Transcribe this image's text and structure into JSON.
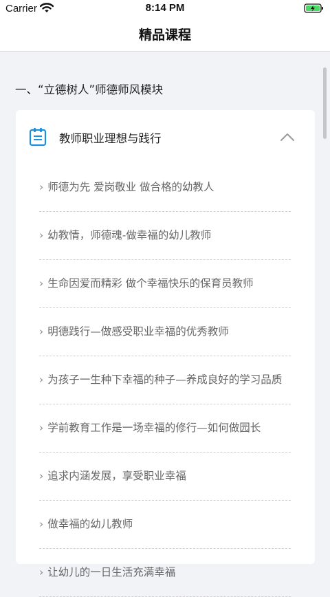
{
  "status_bar": {
    "carrier": "Carrier",
    "time": "8:14 PM"
  },
  "nav": {
    "title": "精品课程"
  },
  "section": {
    "title": "一、“立德树人”师德师风模块"
  },
  "card": {
    "title": "教师职业理想与践行",
    "header_icon": "clipboard-icon",
    "toggle_icon": "chevron-up-icon",
    "expanded": true,
    "lessons": [
      "师德为先 爱岗敬业 做合格的幼教人",
      "幼教情，师德魂-做幸福的幼儿教师",
      "生命因爱而精彩 做个幸福快乐的保育员教师",
      "明德践行—做感受职业幸福的优秀教师",
      "为孩子一生种下幸福的种子—养成良好的学习品质",
      "学前教育工作是一场幸福的修行—如何做园长",
      "追求内涵发展，享受职业幸福",
      "做幸福的幼儿教师",
      "让幼儿的一日生活充满幸福"
    ]
  },
  "colors": {
    "accent": "#1a8fe0",
    "background": "#f2f3f7",
    "battery": "#4cd964"
  }
}
